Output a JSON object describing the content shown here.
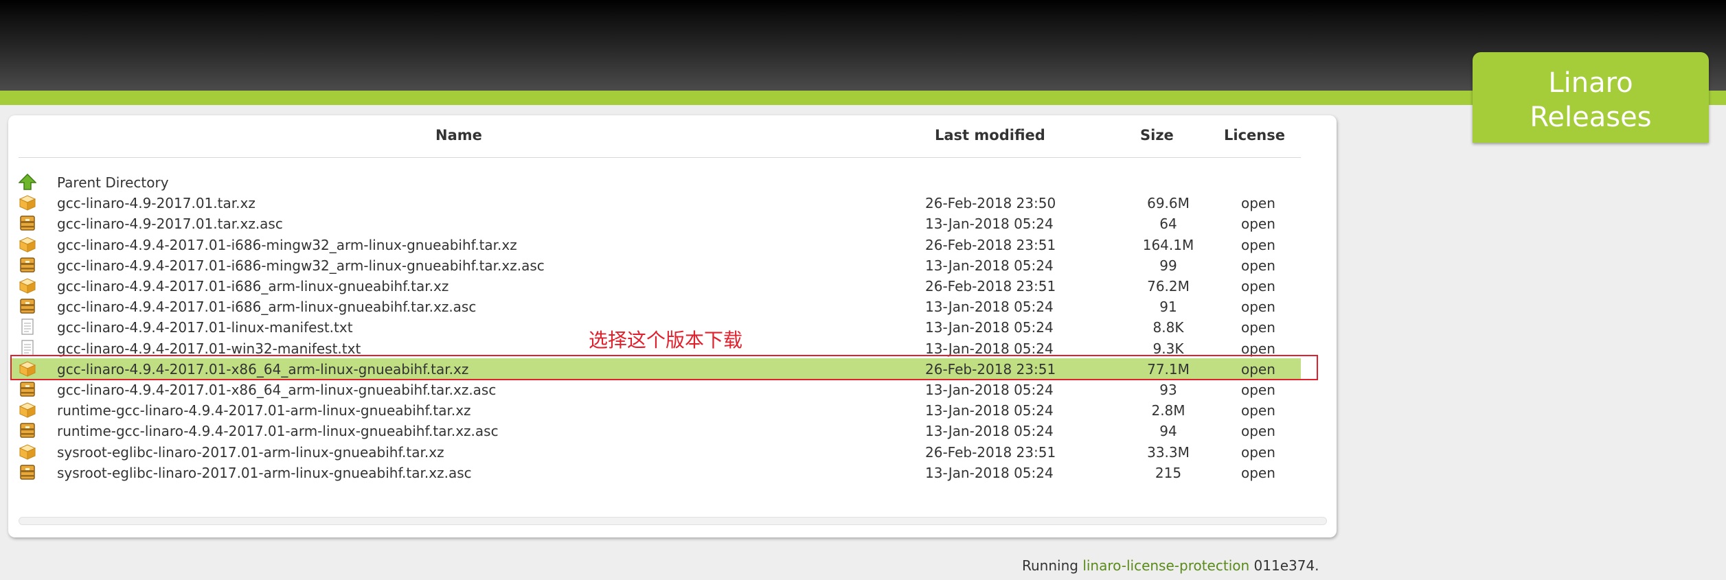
{
  "brand": {
    "line1": "Linaro",
    "line2": "Releases",
    "accent_color": "#a5cd39"
  },
  "table": {
    "headers": {
      "name": "Name",
      "last_modified": "Last modified",
      "size": "Size",
      "license": "License"
    },
    "parent_label": "Parent Directory",
    "rows": [
      {
        "name": "gcc-linaro-4.9-2017.01.tar.xz",
        "date": "26-Feb-2018 23:50",
        "size": "69.6M",
        "license": "open",
        "icon": "package-icon"
      },
      {
        "name": "gcc-linaro-4.9-2017.01.tar.xz.asc",
        "date": "13-Jan-2018 05:24",
        "size": "64",
        "license": "open",
        "icon": "archive-icon"
      },
      {
        "name": "gcc-linaro-4.9.4-2017.01-i686-mingw32_arm-linux-gnueabihf.tar.xz",
        "date": "26-Feb-2018 23:51",
        "size": "164.1M",
        "license": "open",
        "icon": "package-icon"
      },
      {
        "name": "gcc-linaro-4.9.4-2017.01-i686-mingw32_arm-linux-gnueabihf.tar.xz.asc",
        "date": "13-Jan-2018 05:24",
        "size": "99",
        "license": "open",
        "icon": "archive-icon"
      },
      {
        "name": "gcc-linaro-4.9.4-2017.01-i686_arm-linux-gnueabihf.tar.xz",
        "date": "26-Feb-2018 23:51",
        "size": "76.2M",
        "license": "open",
        "icon": "package-icon"
      },
      {
        "name": "gcc-linaro-4.9.4-2017.01-i686_arm-linux-gnueabihf.tar.xz.asc",
        "date": "13-Jan-2018 05:24",
        "size": "91",
        "license": "open",
        "icon": "archive-icon"
      },
      {
        "name": "gcc-linaro-4.9.4-2017.01-linux-manifest.txt",
        "date": "13-Jan-2018 05:24",
        "size": "8.8K",
        "license": "open",
        "icon": "text-file-icon"
      },
      {
        "name": "gcc-linaro-4.9.4-2017.01-win32-manifest.txt",
        "date": "13-Jan-2018 05:24",
        "size": "9.3K",
        "license": "open",
        "icon": "text-file-icon"
      },
      {
        "name": "gcc-linaro-4.9.4-2017.01-x86_64_arm-linux-gnueabihf.tar.xz",
        "date": "26-Feb-2018 23:51",
        "size": "77.1M",
        "license": "open",
        "icon": "package-icon"
      },
      {
        "name": "gcc-linaro-4.9.4-2017.01-x86_64_arm-linux-gnueabihf.tar.xz.asc",
        "date": "13-Jan-2018 05:24",
        "size": "93",
        "license": "open",
        "icon": "archive-icon"
      },
      {
        "name": "runtime-gcc-linaro-4.9.4-2017.01-arm-linux-gnueabihf.tar.xz",
        "date": "13-Jan-2018 05:24",
        "size": "2.8M",
        "license": "open",
        "icon": "package-icon"
      },
      {
        "name": "runtime-gcc-linaro-4.9.4-2017.01-arm-linux-gnueabihf.tar.xz.asc",
        "date": "13-Jan-2018 05:24",
        "size": "94",
        "license": "open",
        "icon": "archive-icon"
      },
      {
        "name": "sysroot-eglibc-linaro-2017.01-arm-linux-gnueabihf.tar.xz",
        "date": "26-Feb-2018 23:51",
        "size": "33.3M",
        "license": "open",
        "icon": "package-icon"
      },
      {
        "name": "sysroot-eglibc-linaro-2017.01-arm-linux-gnueabihf.tar.xz.asc",
        "date": "13-Jan-2018 05:24",
        "size": "215",
        "license": "open",
        "icon": "archive-icon"
      }
    ],
    "highlighted_row": 8,
    "highlight_color": "#bfdf82"
  },
  "annotation": {
    "text": "选择这个版本下载",
    "color": "#e0202c"
  },
  "footer": {
    "prefix": "Running ",
    "link": "linaro-license-protection",
    "suffix": " 011e374."
  }
}
